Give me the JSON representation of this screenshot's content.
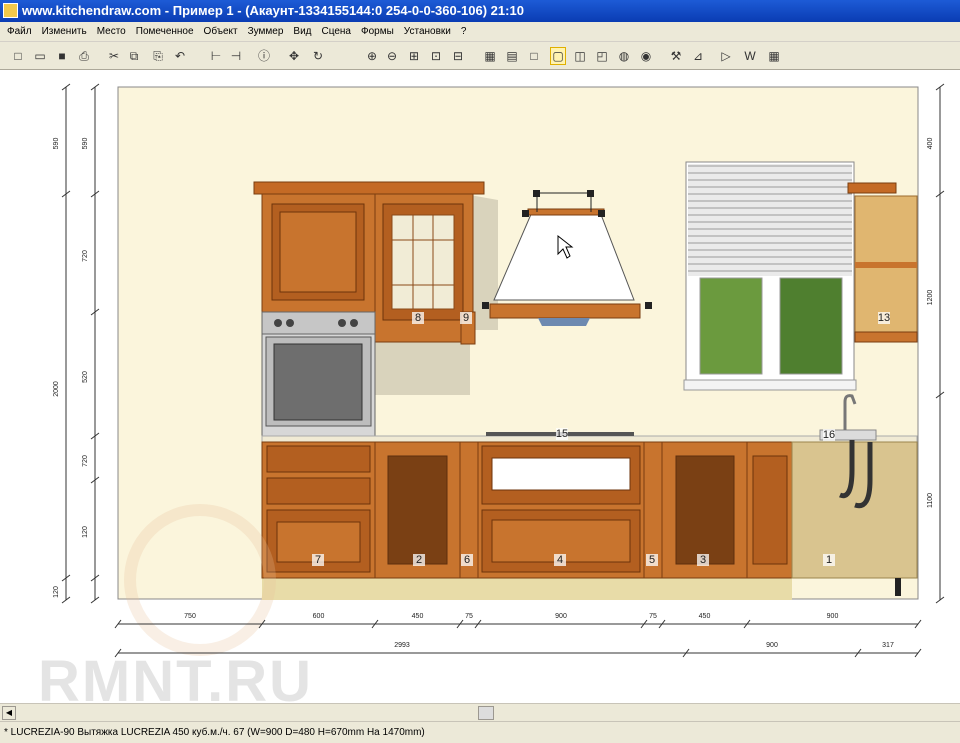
{
  "window": {
    "title": "www.kitchendraw.com - Пример 1 - (Акаунт-1334155144:0 254-0-0-360-106) 21:10"
  },
  "menu": [
    "Файл",
    "Изменить",
    "Место",
    "Помеченное",
    "Объект",
    "Зуммер",
    "Вид",
    "Сцена",
    "Формы",
    "Установки",
    "?"
  ],
  "toolbar": {
    "icons": [
      "new-file-icon",
      "open-folder-icon",
      "save-icon",
      "print-icon",
      "cut-icon",
      "copy-icon",
      "paste-icon",
      "undo-icon",
      "insert-item-icon",
      "dimension-icon",
      "info-icon",
      "move-icon",
      "rotate-icon",
      "zoom-in-icon",
      "zoom-out-icon",
      "zoom-window-icon",
      "zoom-all-icon",
      "zoom-prev-icon",
      "plan-view-icon",
      "elevation-view-icon",
      "wireframe-icon",
      "color-view-icon",
      "perspective-view-icon",
      "3d-view-icon",
      "render-icon",
      "photo-icon",
      "tools-icon",
      "walls-icon",
      "export-icon",
      "word-icon",
      "spreadsheet-icon"
    ],
    "selected_index": 21
  },
  "drawing": {
    "vertical_dims_left_outer": [
      "590",
      "2000",
      "120"
    ],
    "vertical_dims_left_inner": [
      "590",
      "720",
      "520",
      "720",
      "120"
    ],
    "vertical_dims_right": [
      "400",
      "1200",
      "1100"
    ],
    "horizontal_dims_row1": [
      "750",
      "600",
      "450",
      "75",
      "900",
      "75",
      "450",
      "900"
    ],
    "horizontal_dims_row2": [
      "2993",
      "900",
      "317"
    ],
    "item_labels": [
      "8",
      "9",
      "13",
      "15",
      "16",
      "7",
      "2",
      "6",
      "4",
      "5",
      "3",
      "1"
    ]
  },
  "watermark": "RMNT.RU",
  "status": "* LUCREZIA-90  Вытяжка LUCREZIA 450 куб.м./ч. 67  (W=900 D=480 H=670mm На 1470mm)"
}
